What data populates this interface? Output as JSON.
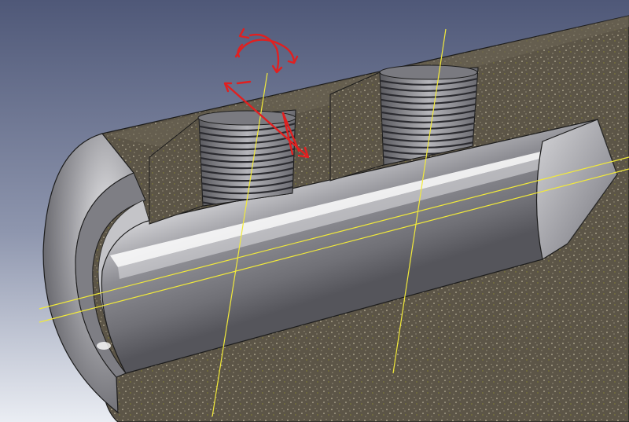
{
  "viewport": {
    "background_top": "#4f5878",
    "background_bottom": "#eaedf3",
    "section_fill": "#5c5547",
    "speckle_color": "#bfb79d",
    "speckle_accent": "#8a8836",
    "steel_light": "#f2f2f3",
    "steel_mid": "#9a9aa0",
    "steel_dark": "#505056",
    "edge_color": "#1c1c1c"
  },
  "model": {
    "parts": [
      {
        "name": "tube-body",
        "kind": "section-cut-body"
      },
      {
        "name": "rounded-end-cap",
        "kind": "revolved-face"
      },
      {
        "name": "bore-channel",
        "kind": "cylindrical-face"
      },
      {
        "name": "threaded-hole-1",
        "kind": "thread-feature"
      },
      {
        "name": "threaded-hole-2",
        "kind": "thread-feature"
      },
      {
        "name": "conical-drill-end",
        "kind": "cone-face"
      }
    ],
    "work_axis_color": "#f2ea3a",
    "axis_count": 4
  },
  "gizmo": {
    "color": "#e02020",
    "handles": [
      "rotate-handle",
      "move-handle"
    ]
  }
}
